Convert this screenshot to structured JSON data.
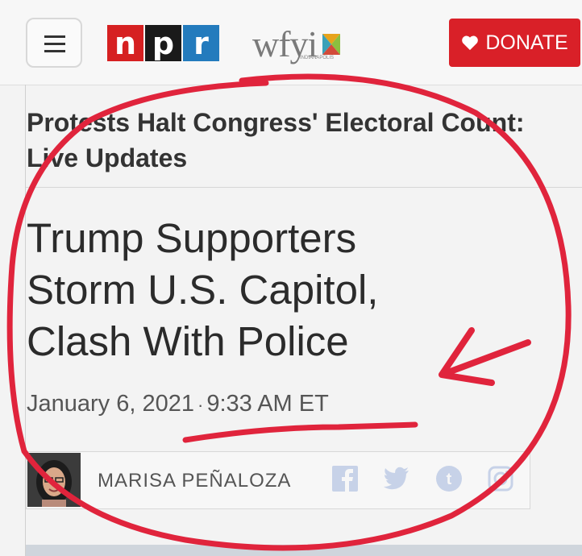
{
  "header": {
    "logo_npr": [
      "n",
      "p",
      "r"
    ],
    "logo_npr_colors": [
      "#d62021",
      "#1a1a1a",
      "#237bbd"
    ],
    "logo_station": "wfyi",
    "station_sub": "INDIANAPOLIS",
    "donate_label": "DONATE",
    "accent": "#d92028"
  },
  "article": {
    "top_story": "Protests Halt Congress' Electoral Count: Live Updates",
    "headline_lines": [
      "Trump Supporters",
      "Storm U.S. Capitol,",
      "Clash With Police"
    ],
    "date": "January 6, 2021",
    "separator": "·",
    "time": "9:33 AM ET",
    "author": "MARISA PEÑALOZA"
  },
  "social_icons": [
    "facebook-icon",
    "twitter-icon",
    "tumblr-icon",
    "instagram-icon"
  ]
}
